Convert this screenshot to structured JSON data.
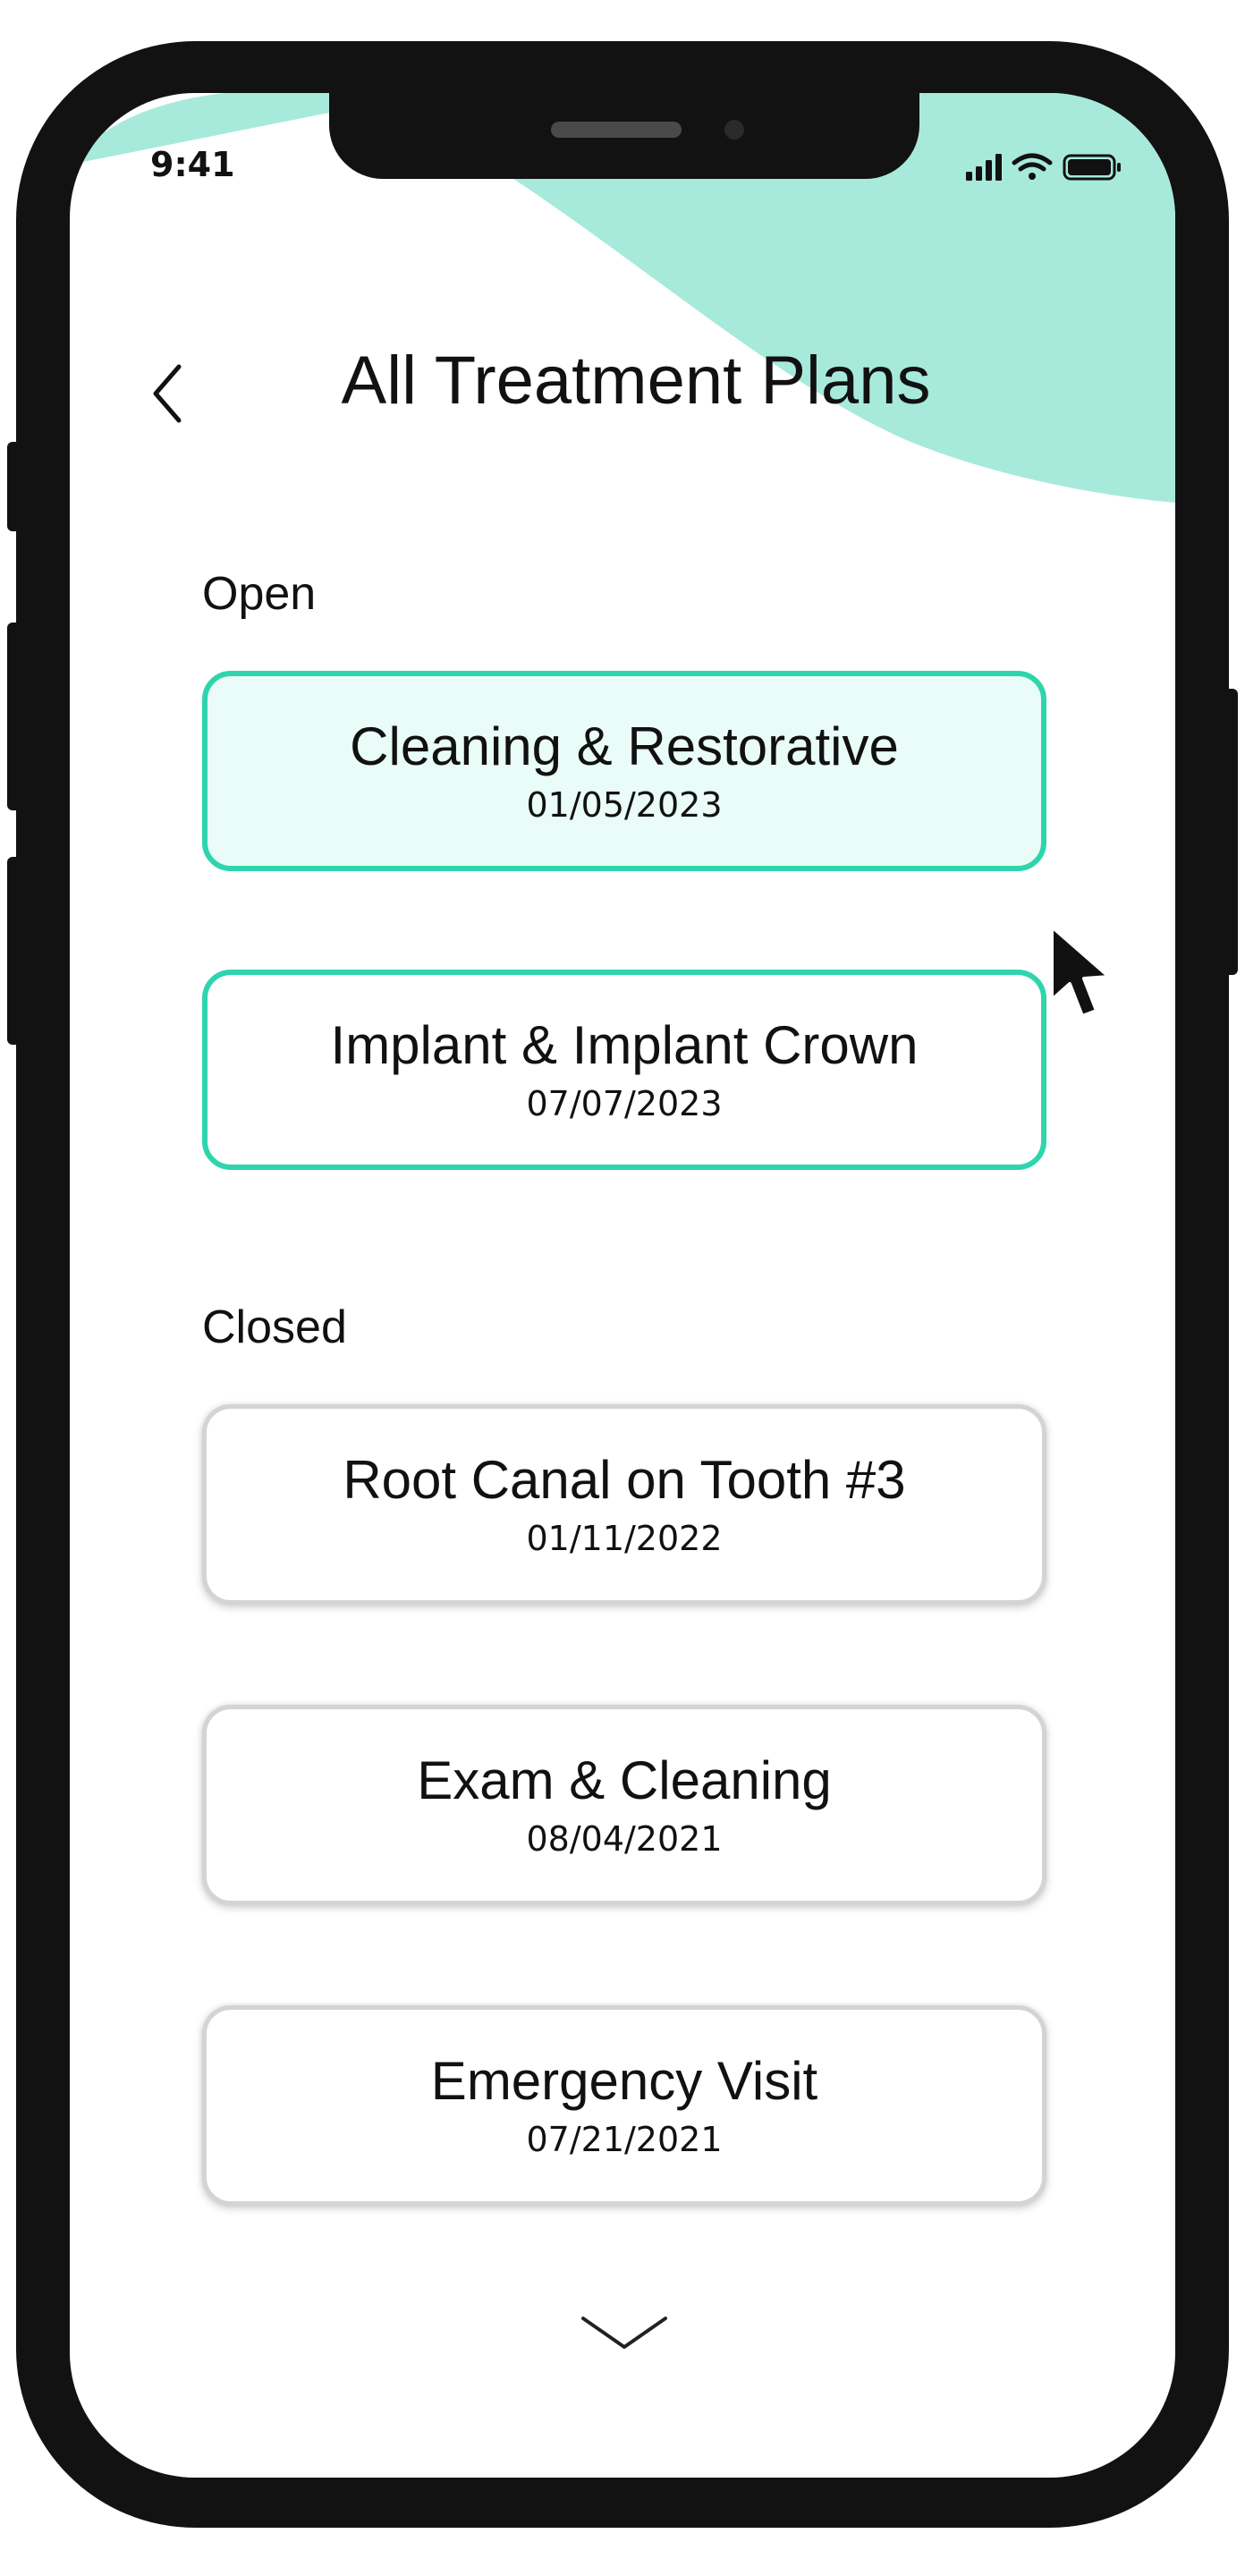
{
  "status_bar": {
    "time": "9:41"
  },
  "header": {
    "title": "All Treatment Plans"
  },
  "sections": {
    "open": {
      "label": "Open",
      "items": [
        {
          "name": "Cleaning & Restorative",
          "date": "01/05/2023"
        },
        {
          "name": "Implant & Implant Crown",
          "date": "07/07/2023"
        }
      ]
    },
    "closed": {
      "label": "Closed",
      "items": [
        {
          "name": "Root Canal on Tooth #3",
          "date": "01/11/2022"
        },
        {
          "name": "Exam & Cleaning",
          "date": "08/04/2021"
        },
        {
          "name": "Emergency Visit",
          "date": "07/21/2021"
        }
      ]
    }
  },
  "icons": {
    "back": "chevron-left-icon",
    "more": "chevron-down-icon",
    "pointer": "mouse-cursor-icon",
    "signal": "cellular-signal-icon",
    "wifi": "wifi-icon",
    "battery": "battery-icon"
  },
  "colors": {
    "accent": "#2ed5ac",
    "accent_wave": "#a7eadb",
    "active_fill": "#e9fcf7",
    "closed_border": "#d4d4d4",
    "frame": "#121212"
  }
}
